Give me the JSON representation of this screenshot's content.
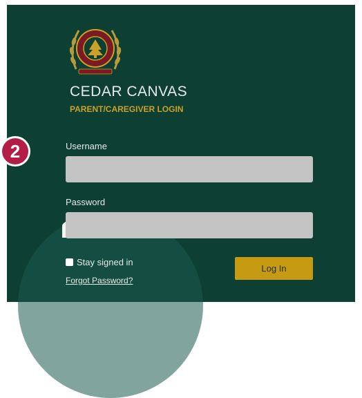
{
  "logo": {
    "icon": "cedar-college-crest-icon",
    "text_top": "CEDAR COLLEGE",
    "motto": "GROWING IN WISDOM"
  },
  "header": {
    "title": "CEDAR CANVAS",
    "subtitle": "PARENT/CAREGIVER LOGIN"
  },
  "badge": {
    "number": "2"
  },
  "form": {
    "username_label": "Username",
    "username_value": "",
    "password_label": "Password",
    "password_value": "",
    "stay_signed_in_label": "Stay signed in",
    "stay_signed_in_checked": false,
    "forgot_password_label": "Forgot Password?",
    "login_button_label": "Log In"
  },
  "colors": {
    "panel_background": "#0e3f33",
    "accent_gold": "#c49b12",
    "subtitle_gold": "#c9a227",
    "badge_red": "#b41e46",
    "field_gray": "#c2c3c2"
  }
}
